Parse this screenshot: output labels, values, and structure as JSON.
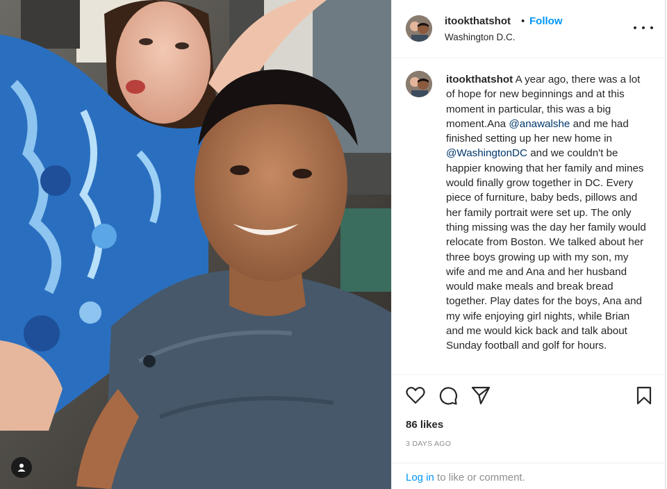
{
  "post": {
    "username": "itookthatshot",
    "separator": "•",
    "follow_label": "Follow",
    "location": "Washington D.C."
  },
  "caption": {
    "author": "itookthatshot",
    "part1": " A year ago, there was a lot of hope for new beginnings and at this moment in particular, this was a big moment.Ana ",
    "mention1": "@anawalshe",
    "part2": " and me had finished setting up her new home in ",
    "mention2": "@WashingtonDC",
    "part3": " and we couldn't be happier knowing that her family and mines would finally grow together in DC. Every piece of furniture, baby beds, pillows and her family portrait were set up. The only thing missing was the day her family would relocate from Boston. We talked about her three boys growing up with my son, my wife and me and Ana and her husband would make meals and break bread together. Play dates for the boys, Ana and my wife enjoying girl nights, while Brian and me would kick back and talk about Sunday football and golf for hours."
  },
  "stats": {
    "likes": "86 likes",
    "time": "3 DAYS AGO"
  },
  "login": {
    "link": "Log in",
    "rest": " to like or comment."
  },
  "icons": {
    "like": "heart-icon",
    "comment": "comment-icon",
    "share": "paper-plane-icon",
    "save": "bookmark-icon",
    "more": "more-options-icon",
    "tag": "user-tag-icon"
  },
  "colors": {
    "accent": "#0095f6",
    "mention": "#00376b",
    "muted": "#8e8e8e"
  }
}
